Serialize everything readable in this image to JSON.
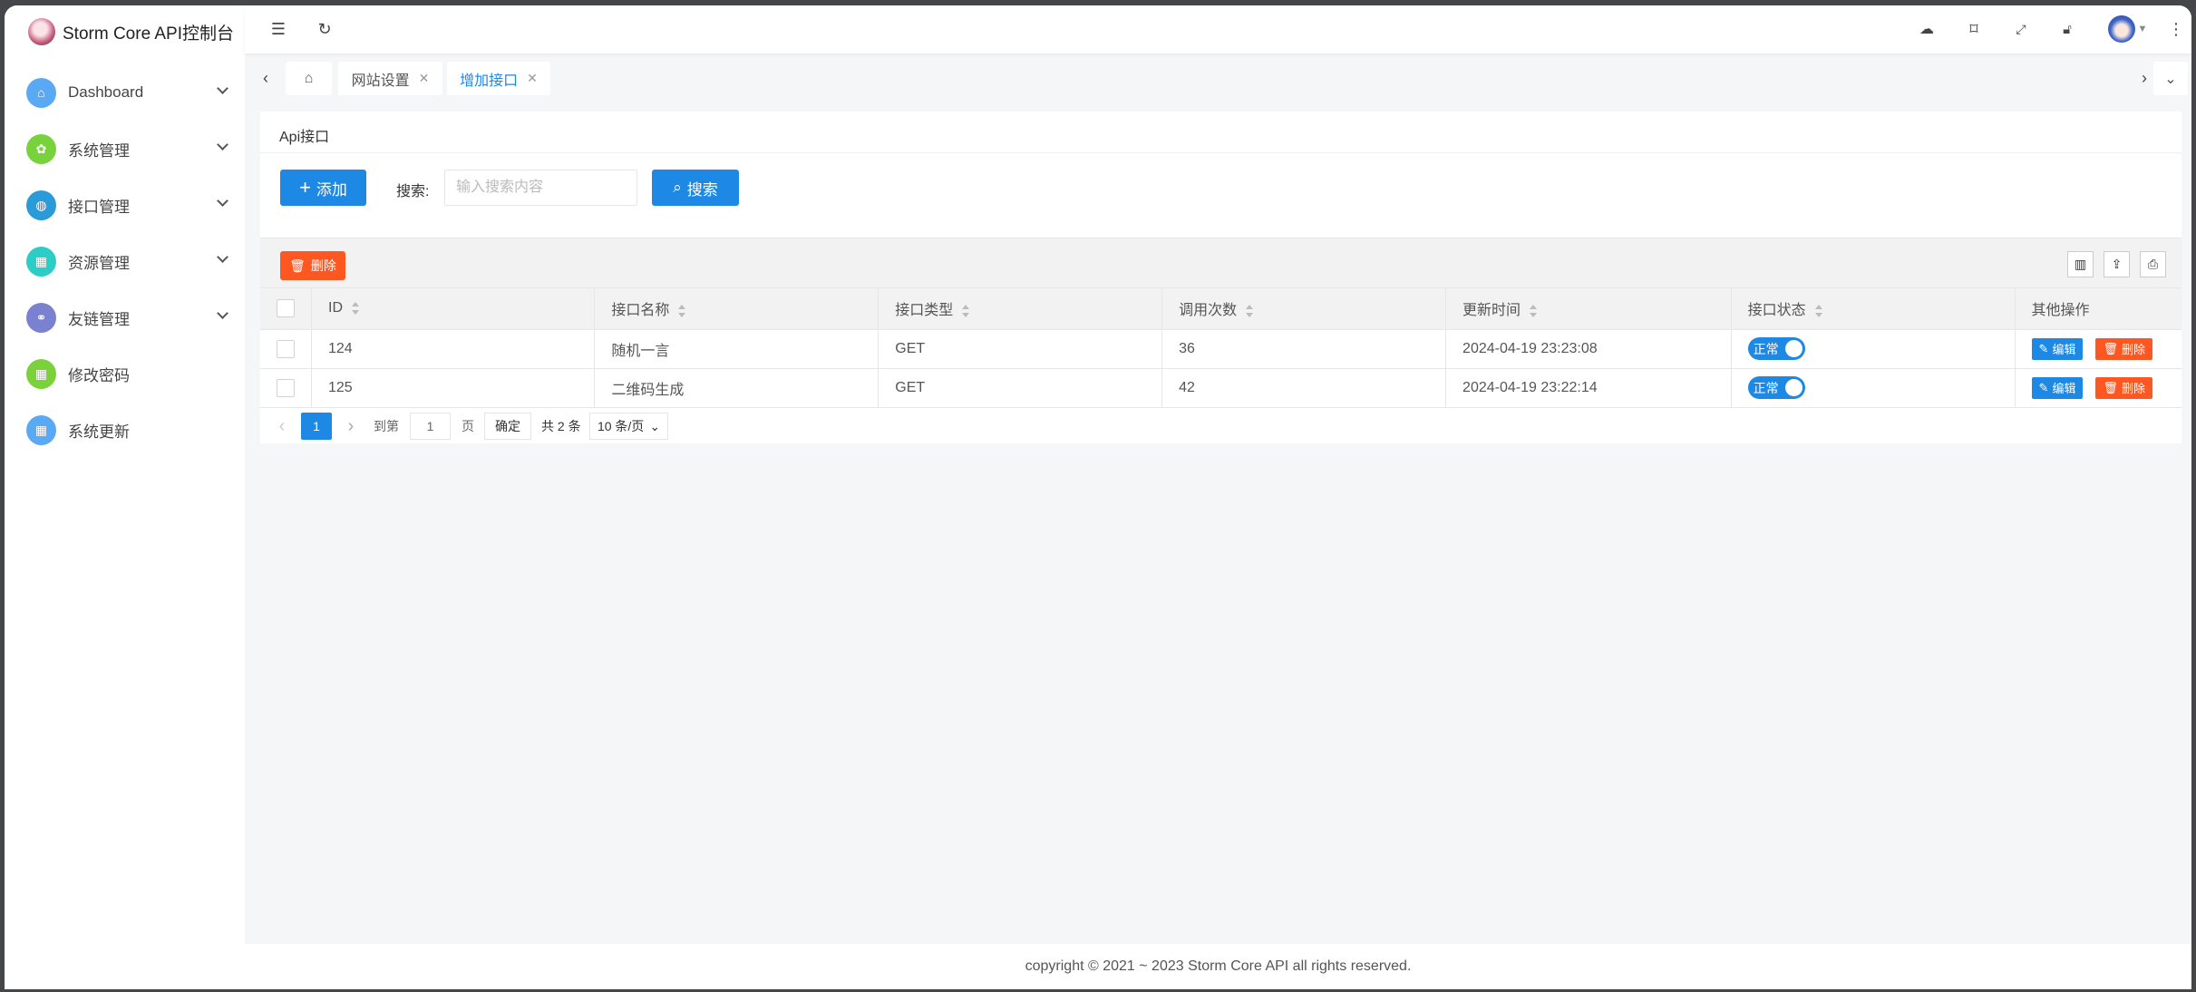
{
  "app": {
    "title": "Storm Core API控制台"
  },
  "sidebar": {
    "items": [
      {
        "label": "Dashboard",
        "icon": "home-icon",
        "color": "#5aa9f5",
        "expandable": true
      },
      {
        "label": "系统管理",
        "icon": "gear-icon",
        "color": "#78d23c",
        "expandable": true
      },
      {
        "label": "接口管理",
        "icon": "globe-icon",
        "color": "#2a9bd8",
        "expandable": true
      },
      {
        "label": "资源管理",
        "icon": "grid-icon",
        "color": "#2ccdc6",
        "expandable": true
      },
      {
        "label": "友链管理",
        "icon": "link-icon",
        "color": "#7a81d1",
        "expandable": true
      },
      {
        "label": "修改密码",
        "icon": "grid-icon",
        "color": "#7bd13a",
        "expandable": false
      },
      {
        "label": "系统更新",
        "icon": "grid-icon",
        "color": "#5aa9f5",
        "expandable": false
      }
    ]
  },
  "header": {
    "icons": [
      "menu-fold-icon",
      "refresh-icon",
      "cloud-code-icon",
      "tag-icon",
      "fullscreen-icon",
      "lock-icon",
      "user-avatar",
      "more-icon"
    ]
  },
  "tabs": [
    {
      "label": "网站设置",
      "active": false
    },
    {
      "label": "增加接口",
      "active": true
    }
  ],
  "card": {
    "title": "Api接口",
    "add_label": "添加",
    "search_label": "搜索:",
    "search_placeholder": "输入搜索内容",
    "search_value": "",
    "search_button": "搜索",
    "batch_delete": "删除"
  },
  "table": {
    "columns": [
      "ID",
      "接口名称",
      "接口类型",
      "调用次数",
      "更新时间",
      "接口状态",
      "其他操作"
    ],
    "rows": [
      {
        "id": "124",
        "name": "随机一言",
        "type": "GET",
        "calls": "36",
        "updated": "2024-04-19 23:23:08",
        "status": "正常",
        "edit": "编辑",
        "delete": "删除"
      },
      {
        "id": "125",
        "name": "二维码生成",
        "type": "GET",
        "calls": "42",
        "updated": "2024-04-19 23:22:14",
        "status": "正常",
        "edit": "编辑",
        "delete": "删除"
      }
    ]
  },
  "pagination": {
    "current": "1",
    "goto_label": "到第",
    "goto_value": "1",
    "page_unit": "页",
    "confirm": "确定",
    "total": "共 2 条",
    "page_size": "10 条/页"
  },
  "footer": {
    "text": "copyright © 2021 ~ 2023 Storm Core API all rights reserved."
  },
  "colors": {
    "primary": "#1e88e5",
    "danger": "#ff5722"
  }
}
